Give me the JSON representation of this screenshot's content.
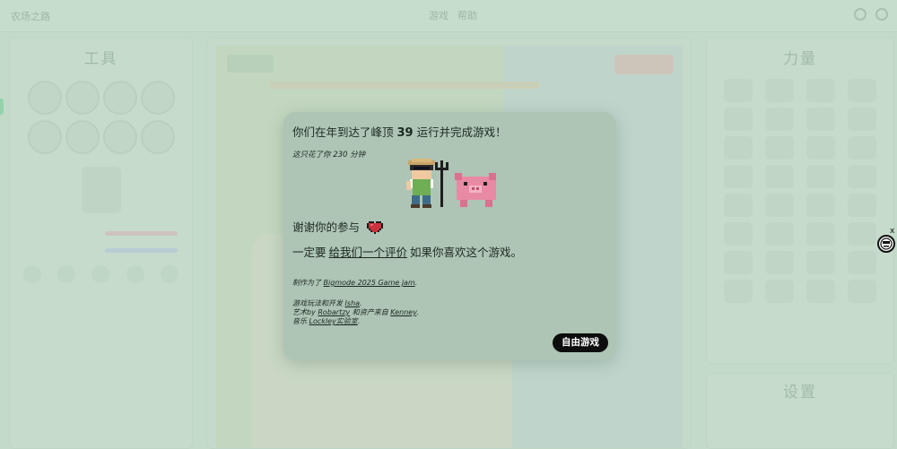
{
  "app": {
    "title": "农场之路",
    "nav": [
      "游戏",
      "帮助"
    ]
  },
  "left_panel": {
    "heading": "工具"
  },
  "right_panel": {
    "heading": "力量"
  },
  "settings_panel": {
    "heading": "设置"
  },
  "modal": {
    "headline_before": "你们在年到达了峰顶",
    "headline_number": "39",
    "headline_after": "运行并完成游戏！",
    "time_note": "这只花了你 230 分钟",
    "thanks": "谢谢你的参与",
    "review_before": "一定要",
    "review_link": "给我们一个评价",
    "review_after": "如果你喜欢这个游戏。",
    "made_for_before": "制作为了",
    "made_for_link": "Bigmode 2025 Game jam",
    "made_for_after": ".",
    "gameplay_before": "游戏玩法和开发",
    "gameplay_link": "Isha",
    "gameplay_after": ".",
    "art_before": "艺术by",
    "art_link": "Robartzy",
    "art_mid": "和资产来自",
    "assets_link": "Kenney",
    "art_after": ".",
    "music_before": "音乐",
    "music_link": "Lockley实验室",
    "music_after": ".",
    "free_play_button": "自由游戏"
  },
  "helper": {
    "close_label": "x"
  },
  "colors": {
    "modal_bg": "#aec4b4",
    "button_bg": "#0d0d0d",
    "heart": "#c8333d"
  }
}
